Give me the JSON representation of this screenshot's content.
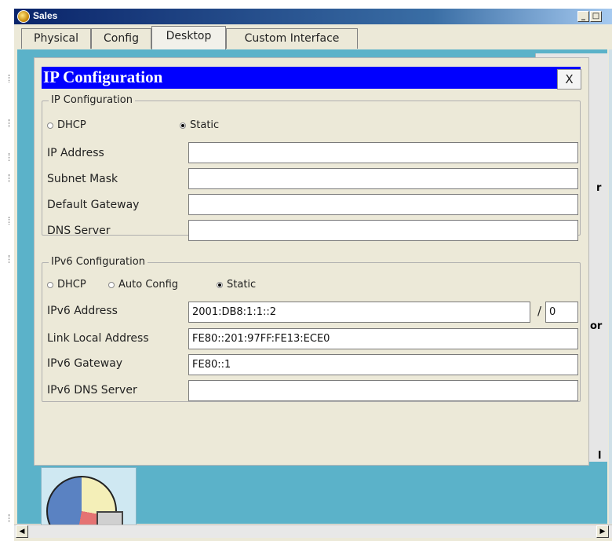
{
  "window": {
    "title": "Sales",
    "buttons": {
      "minimize": "_",
      "maximize": "□"
    }
  },
  "tabs": [
    {
      "label": "Physical"
    },
    {
      "label": "Config"
    },
    {
      "label": "Desktop"
    },
    {
      "label": "Custom Interface"
    }
  ],
  "active_tab": "Desktop",
  "side_text": {
    "a": "r",
    "b": "or",
    "c": "l"
  },
  "dialog": {
    "title": "IP Configuration",
    "close_label": "X",
    "ipv4": {
      "legend": "IP Configuration",
      "mode_dhcp": "DHCP",
      "mode_static": "Static",
      "selected_mode": "Static",
      "fields": [
        {
          "label": "IP Address",
          "value": ""
        },
        {
          "label": "Subnet Mask",
          "value": ""
        },
        {
          "label": "Default Gateway",
          "value": ""
        },
        {
          "label": "DNS Server",
          "value": ""
        }
      ]
    },
    "ipv6": {
      "legend": "IPv6 Configuration",
      "mode_dhcp": "DHCP",
      "mode_auto": "Auto Config",
      "mode_static": "Static",
      "selected_mode": "Static",
      "address_label": "IPv6 Address",
      "address_value": "2001:DB8:1:1::2",
      "prefix_separator": "/",
      "prefix_value": "0",
      "link_local_label": "Link Local Address",
      "link_local_value": "FE80::201:97FF:FE13:ECE0",
      "gateway_label": "IPv6 Gateway",
      "gateway_value": "FE80::1",
      "dns_label": "IPv6 DNS Server",
      "dns_value": ""
    }
  },
  "scrollbar": {
    "left_arrow": "◀",
    "right_arrow": "▶"
  }
}
